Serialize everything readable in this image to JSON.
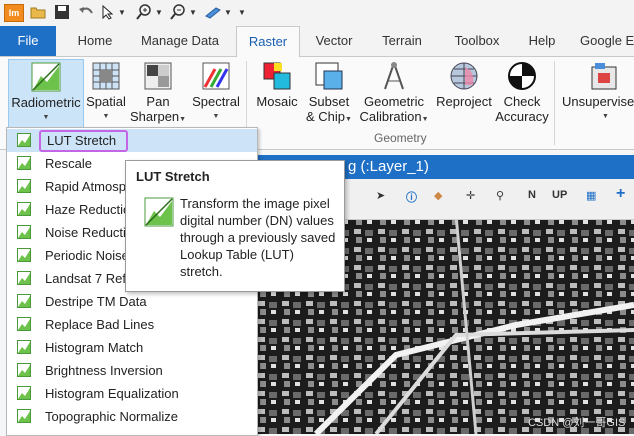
{
  "quick_access": {
    "logo": "lm",
    "icons": [
      "open-icon",
      "save-icon",
      "undo-icon",
      "select-icon",
      "zoom-in-icon",
      "zoom-out-icon",
      "pan-icon",
      "customize-icon"
    ]
  },
  "tabs": [
    "File",
    "Home",
    "Manage Data",
    "Raster",
    "Vector",
    "Terrain",
    "Toolbox",
    "Help",
    "Google E"
  ],
  "ribbon": {
    "buttons": [
      {
        "label1": "Radiometric",
        "label2": "",
        "dropdown": true
      },
      {
        "label1": "Spatial",
        "label2": "",
        "dropdown": true
      },
      {
        "label1": "Pan",
        "label2": "Sharpen",
        "dropdown": true
      },
      {
        "label1": "Spectral",
        "label2": "",
        "dropdown": true
      },
      {
        "label1": "Mosaic",
        "label2": "",
        "dropdown": false
      },
      {
        "label1": "Subset",
        "label2": "& Chip",
        "dropdown": true
      },
      {
        "label1": "Geometric",
        "label2": "Calibration",
        "dropdown": true
      },
      {
        "label1": "Reproject",
        "label2": "",
        "dropdown": false
      },
      {
        "label1": "Check",
        "label2": "Accuracy",
        "dropdown": false
      },
      {
        "label1": "Unsupervise",
        "label2": "",
        "dropdown": true
      }
    ],
    "group_label": "Geometry"
  },
  "map_window": {
    "title": "g (:Layer_1)",
    "tools": [
      "N",
      "UP"
    ]
  },
  "menu": {
    "items": [
      "LUT Stretch",
      "Rescale",
      "Rapid Atmosp",
      "Haze Reductio",
      "Noise Reducti",
      "Periodic Noise",
      "Landsat 7 Refl",
      "Destripe TM Data",
      "Replace Bad Lines",
      "Histogram Match",
      "Brightness Inversion",
      "Histogram Equalization",
      "Topographic Normalize"
    ],
    "highlighted_index": 0
  },
  "tooltip": {
    "title": "LUT Stretch",
    "description": "Transform the image pixel digital number (DN) values through a previously saved Lookup Table (LUT) stretch."
  },
  "watermark": "CSDN @刘一哥GIS",
  "colors": {
    "file_tab": "#1e6fc6",
    "active_tab_text": "#1a5fb4",
    "highlight": "#cde3f7",
    "highlight_border": "#c266e6"
  }
}
